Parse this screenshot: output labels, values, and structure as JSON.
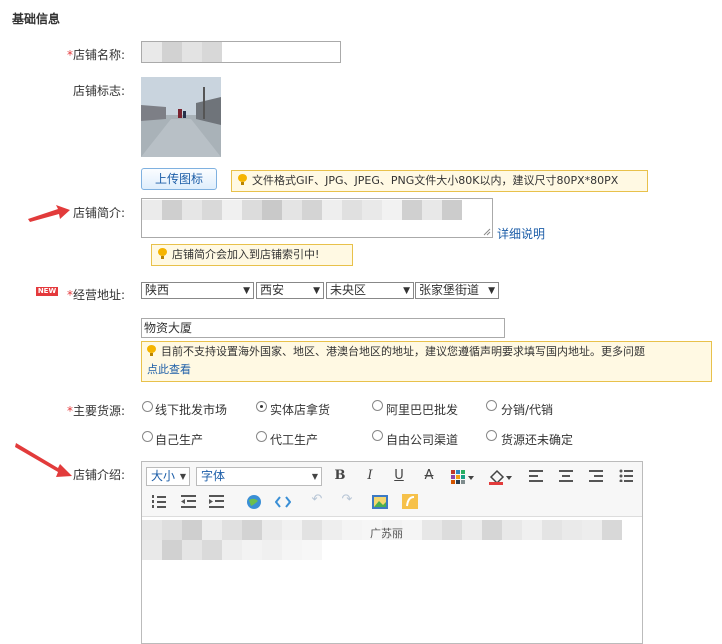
{
  "section": {
    "title": "基础信息"
  },
  "store_name": {
    "required": "*",
    "label": "店铺名称:"
  },
  "store_logo": {
    "label": "店铺标志:"
  },
  "upload": {
    "button": "上传图标",
    "tip": "文件格式GIF、JPG、JPEG、PNG文件大小80K以内，建议尺寸80PX*80PX"
  },
  "store_intro": {
    "label": "店铺简介:",
    "detail_link": "详细说明",
    "tip": "店铺简介会加入到店铺索引中!"
  },
  "address": {
    "new_badge": "NEW",
    "required": "*",
    "label": "经营地址:",
    "province": "陕西",
    "city": "西安",
    "district": "未央区",
    "street": "张家堡街道",
    "detail": "物资大厦",
    "tip": "目前不支持设置海外国家、地区、港澳台地区的地址，建议您遵循声明要求填写国内地址。更多问题",
    "tip_link": "点此查看"
  },
  "supply": {
    "required": "*",
    "label": "主要货源:",
    "options": [
      "线下批发市场",
      "实体店拿货",
      "阿里巴巴批发",
      "分销/代销",
      "自己生产",
      "代工生产",
      "自由公司渠道",
      "货源还未确定"
    ],
    "selected": "实体店拿货"
  },
  "store_desc": {
    "label": "店铺介绍:",
    "font_size": "大小",
    "font_family": "字体",
    "visible_fragment": "广苏丽"
  },
  "colors": {
    "required": "#e4393c",
    "link": "#1d5ea8",
    "tip_border": "#e8c14b",
    "tip_bg": "#fff9e3"
  }
}
